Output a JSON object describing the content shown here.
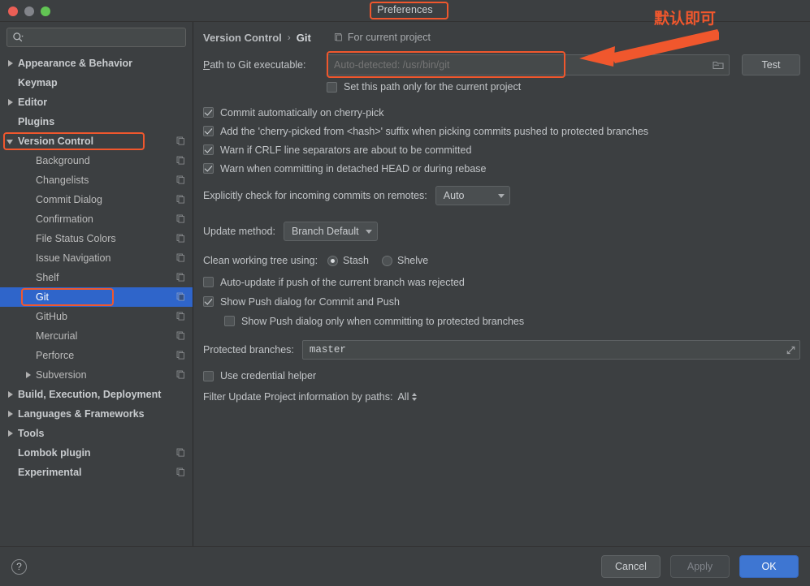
{
  "window": {
    "title": "Preferences",
    "traffic_lights": [
      "close-button",
      "minimize-button",
      "maximize-button"
    ]
  },
  "sidebar": {
    "search": {
      "value": "",
      "placeholder": "",
      "icon": "search-icon"
    },
    "items": [
      {
        "label": "Appearance & Behavior",
        "level": 0,
        "twisty": "collapsed",
        "bold": true,
        "scope_icon": false,
        "selected": false
      },
      {
        "label": "Keymap",
        "level": 0,
        "twisty": "none",
        "bold": true,
        "scope_icon": false,
        "selected": false
      },
      {
        "label": "Editor",
        "level": 0,
        "twisty": "collapsed",
        "bold": true,
        "scope_icon": false,
        "selected": false
      },
      {
        "label": "Plugins",
        "level": 0,
        "twisty": "none",
        "bold": true,
        "scope_icon": false,
        "selected": false
      },
      {
        "label": "Version Control",
        "level": 0,
        "twisty": "expanded",
        "bold": true,
        "scope_icon": true,
        "selected": false
      },
      {
        "label": "Background",
        "level": 1,
        "twisty": "none",
        "bold": false,
        "scope_icon": true,
        "selected": false
      },
      {
        "label": "Changelists",
        "level": 1,
        "twisty": "none",
        "bold": false,
        "scope_icon": true,
        "selected": false
      },
      {
        "label": "Commit Dialog",
        "level": 1,
        "twisty": "none",
        "bold": false,
        "scope_icon": true,
        "selected": false
      },
      {
        "label": "Confirmation",
        "level": 1,
        "twisty": "none",
        "bold": false,
        "scope_icon": true,
        "selected": false
      },
      {
        "label": "File Status Colors",
        "level": 1,
        "twisty": "none",
        "bold": false,
        "scope_icon": true,
        "selected": false
      },
      {
        "label": "Issue Navigation",
        "level": 1,
        "twisty": "none",
        "bold": false,
        "scope_icon": true,
        "selected": false
      },
      {
        "label": "Shelf",
        "level": 1,
        "twisty": "none",
        "bold": false,
        "scope_icon": true,
        "selected": false
      },
      {
        "label": "Git",
        "level": 1,
        "twisty": "none",
        "bold": false,
        "scope_icon": true,
        "selected": true
      },
      {
        "label": "GitHub",
        "level": 1,
        "twisty": "none",
        "bold": false,
        "scope_icon": true,
        "selected": false
      },
      {
        "label": "Mercurial",
        "level": 1,
        "twisty": "none",
        "bold": false,
        "scope_icon": true,
        "selected": false
      },
      {
        "label": "Perforce",
        "level": 1,
        "twisty": "none",
        "bold": false,
        "scope_icon": true,
        "selected": false
      },
      {
        "label": "Subversion",
        "level": 1,
        "twisty": "collapsed",
        "bold": false,
        "scope_icon": true,
        "selected": false
      },
      {
        "label": "Build, Execution, Deployment",
        "level": 0,
        "twisty": "collapsed",
        "bold": true,
        "scope_icon": false,
        "selected": false
      },
      {
        "label": "Languages & Frameworks",
        "level": 0,
        "twisty": "collapsed",
        "bold": true,
        "scope_icon": false,
        "selected": false
      },
      {
        "label": "Tools",
        "level": 0,
        "twisty": "collapsed",
        "bold": true,
        "scope_icon": false,
        "selected": false
      },
      {
        "label": "Lombok plugin",
        "level": 0,
        "twisty": "none",
        "bold": true,
        "scope_icon": true,
        "selected": false
      },
      {
        "label": "Experimental",
        "level": 0,
        "twisty": "none",
        "bold": true,
        "scope_icon": true,
        "selected": false
      }
    ]
  },
  "main": {
    "breadcrumb": {
      "parent": "Version Control",
      "separator": "›",
      "current": "Git"
    },
    "scope_note": {
      "text": "For current project",
      "icon": "project-scope-icon"
    },
    "path_row": {
      "label_prefix": "P",
      "label_underlined": "a",
      "label_suffix": "th to Git executable:",
      "label_full": "Path to Git executable:",
      "input_value": "",
      "input_placeholder": "Auto-detected: /usr/bin/git",
      "browse_icon": "folder-icon",
      "test_button": "Test"
    },
    "set_path_project": {
      "label": "Set this path only for the current project",
      "checked": false
    },
    "checkboxes": [
      {
        "label": "Commit automatically on cherry-pick",
        "checked": true
      },
      {
        "label": "Add the 'cherry-picked from <hash>' suffix when picking commits pushed to protected branches",
        "checked": true
      },
      {
        "label": "Warn if CRLF line separators are about to be committed",
        "checked": true
      },
      {
        "label": "Warn when committing in detached HEAD or during rebase",
        "checked": true
      }
    ],
    "incoming_commits": {
      "label": "Explicitly check for incoming commits on remotes:",
      "value": "Auto"
    },
    "update_method": {
      "label": "Update method:",
      "value": "Branch Default"
    },
    "clean_working_tree": {
      "label": "Clean working tree using:",
      "options": [
        {
          "label": "Stash",
          "selected": true
        },
        {
          "label": "Shelve",
          "selected": false
        }
      ]
    },
    "auto_update": {
      "label": "Auto-update if push of the current branch was rejected",
      "checked": false
    },
    "show_push": {
      "label": "Show Push dialog for Commit and Push",
      "checked": true
    },
    "show_push_protected": {
      "label": "Show Push dialog only when committing to protected branches",
      "checked": false
    },
    "protected_branches": {
      "label": "Protected branches:",
      "value": "master",
      "expand_icon": "expand-field-icon"
    },
    "credential_helper": {
      "label": "Use credential helper",
      "checked": false
    },
    "filter_update": {
      "label": "Filter Update Project information by paths:",
      "value": "All"
    }
  },
  "footer": {
    "help": "?",
    "cancel": "Cancel",
    "apply": "Apply",
    "ok": "OK"
  },
  "annotations": {
    "note_text": "默认即可",
    "accent_color": "#f0572d",
    "highlights": [
      "preferences-title",
      "version-control-item",
      "git-item",
      "path-to-git-field"
    ]
  }
}
